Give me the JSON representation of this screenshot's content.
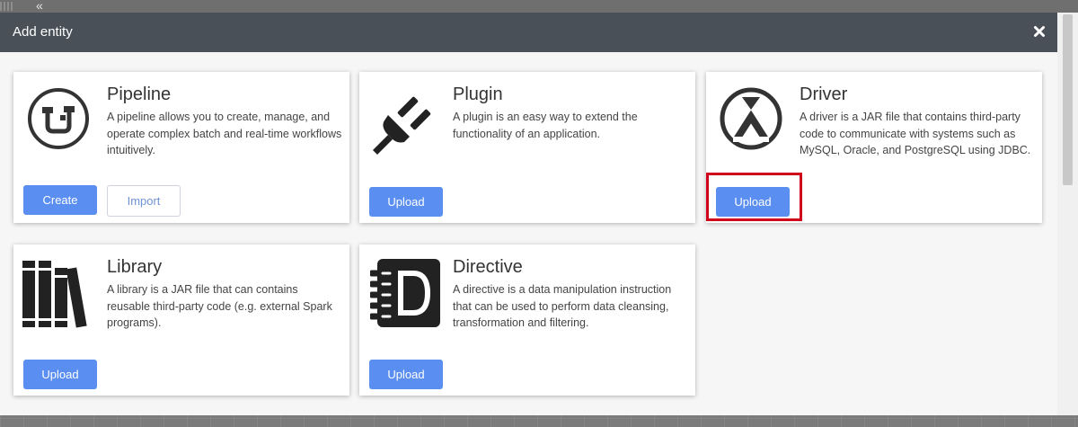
{
  "modal": {
    "title": "Add entity"
  },
  "cards": {
    "pipeline": {
      "name": "Pipeline",
      "description": "A pipeline allows you to create, manage, and operate complex batch and real-time workflows intuitively.",
      "create_label": "Create",
      "import_label": "Import"
    },
    "plugin": {
      "name": "Plugin",
      "description": "A plugin is an easy way to extend the functionality of an application.",
      "upload_label": "Upload"
    },
    "driver": {
      "name": "Driver",
      "description": "A driver is a JAR file that contains third-party code to communicate with systems such as MySQL, Oracle, and PostgreSQL using JDBC.",
      "upload_label": "Upload"
    },
    "library": {
      "name": "Library",
      "description": "A library is a JAR file that can contains reusable third-party code (e.g. external Spark programs).",
      "upload_label": "Upload"
    },
    "directive": {
      "name": "Directive",
      "description": "A directive is a data manipulation instruction that can be used to perform data cleansing, transformation and filtering.",
      "upload_label": "Upload"
    }
  },
  "icons": [
    "grid-icon",
    "collapse-icon",
    "close-icon",
    "pipeline-icon",
    "plugin-icon",
    "driver-icon",
    "library-icon",
    "directive-icon"
  ],
  "colors": {
    "header_bg": "#4a5058",
    "primary_button": "#5a8ef0",
    "highlight": "#d0021b",
    "icon": "#333333"
  }
}
